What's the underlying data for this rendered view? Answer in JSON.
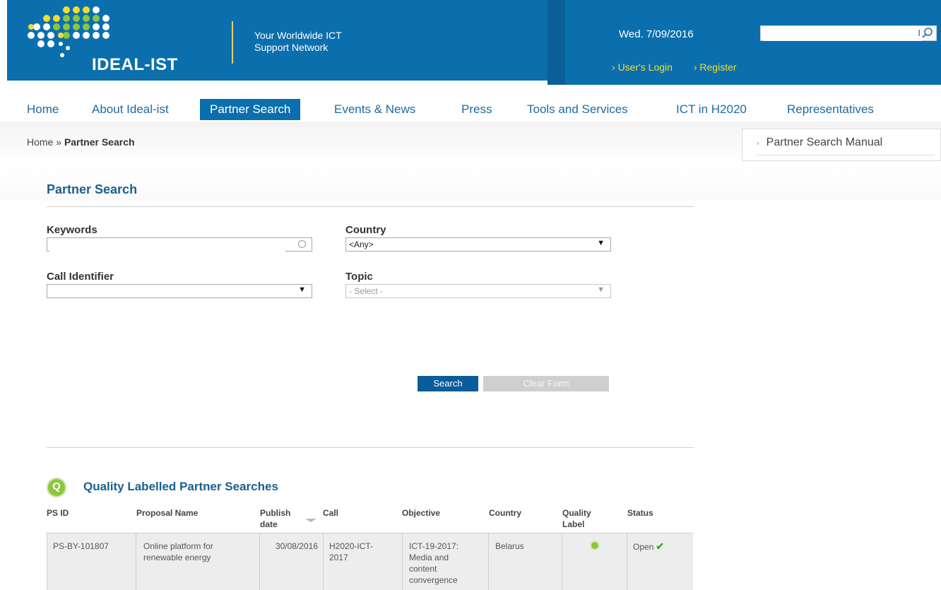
{
  "header": {
    "logo_text": "IDEAL-IST",
    "tagline_line1": "Your Worldwide ICT",
    "tagline_line2": "Support Network",
    "date": "Wed. 7/09/2016",
    "search_value": "",
    "login_link": "User's Login",
    "register_link": "Register",
    "link_prefix": "›"
  },
  "nav": {
    "items": [
      {
        "label": "Home"
      },
      {
        "label": "About Ideal-ist"
      },
      {
        "label": "Partner Search"
      },
      {
        "label": "Events & News"
      },
      {
        "label": "Press"
      },
      {
        "label": "Tools and Services"
      },
      {
        "label": "ICT in H2020"
      },
      {
        "label": "Representatives"
      }
    ],
    "active": "Partner Search"
  },
  "breadcrumb": {
    "home": "Home",
    "separator": "»",
    "current": "Partner Search"
  },
  "sidebar": {
    "manual_link": "Partner Search Manual",
    "arrow": "›"
  },
  "form": {
    "title": "Partner Search",
    "keywords_label": "Keywords",
    "keywords_value": "",
    "country_label": "Country",
    "country_value": "<Any>",
    "call_label": "Call Identifier",
    "call_value": "",
    "topic_label": "Topic",
    "topic_value": "- Select -",
    "search_button": "Search",
    "clear_button": "Clear Form"
  },
  "quality": {
    "icon_letter": "Q",
    "title": "Quality Labelled Partner Searches"
  },
  "table": {
    "headers": {
      "ps_id": "PS ID",
      "proposal": "Proposal Name",
      "publish_1": "Publish",
      "publish_2": "date",
      "call": "Call",
      "objective": "Objective",
      "country": "Country",
      "quality_1": "Quality",
      "quality_2": "Label",
      "status": "Status"
    },
    "rows": [
      {
        "ps_id": "PS-BY-101807",
        "proposal_1": "Online platform for",
        "proposal_2": "renewable energy",
        "publish_date": "30/08/2016",
        "call_1": "H2020-ICT-",
        "call_2": "2017",
        "objective_1": "ICT-19-2017:",
        "objective_2": "Media and",
        "objective_3": "content",
        "objective_4": "convergence",
        "country": "Belarus",
        "status": "Open"
      }
    ]
  },
  "colors": {
    "header_blue": "#0b6fae",
    "link_yellow": "#f3dc2e",
    "nav_blue": "#1c6ba2",
    "title_blue": "#1a5f8f",
    "quality_green": "#8cc63f"
  },
  "icons": [
    "search-icon",
    "keywords-search-icon",
    "chevron-down-icon",
    "sort-icon",
    "quality-label-icon",
    "check-icon"
  ]
}
